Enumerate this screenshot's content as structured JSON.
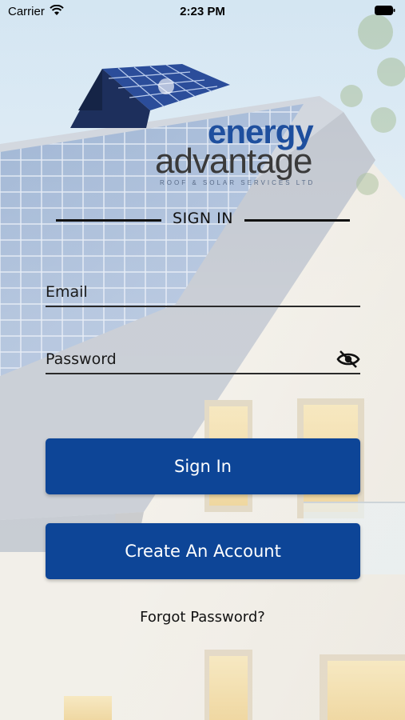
{
  "status_bar": {
    "carrier": "Carrier",
    "time": "2:23 PM",
    "wifi_icon": "wifi-icon",
    "battery_icon": "battery-icon"
  },
  "logo": {
    "word_1": "energy",
    "word_2": "advantage",
    "tagline": "ROOF & SOLAR SERVICES LTD"
  },
  "form": {
    "heading": "SIGN IN",
    "email": {
      "placeholder": "Email",
      "value": ""
    },
    "password": {
      "placeholder": "Password",
      "value": "",
      "toggle_icon": "eye-off-icon"
    }
  },
  "buttons": {
    "sign_in": "Sign In",
    "create_account": "Create An Account"
  },
  "links": {
    "forgot_password": "Forgot Password?"
  },
  "colors": {
    "button": "#0d4597",
    "logo_blue": "#1e4f9e",
    "logo_grey": "#3a3a3a"
  }
}
